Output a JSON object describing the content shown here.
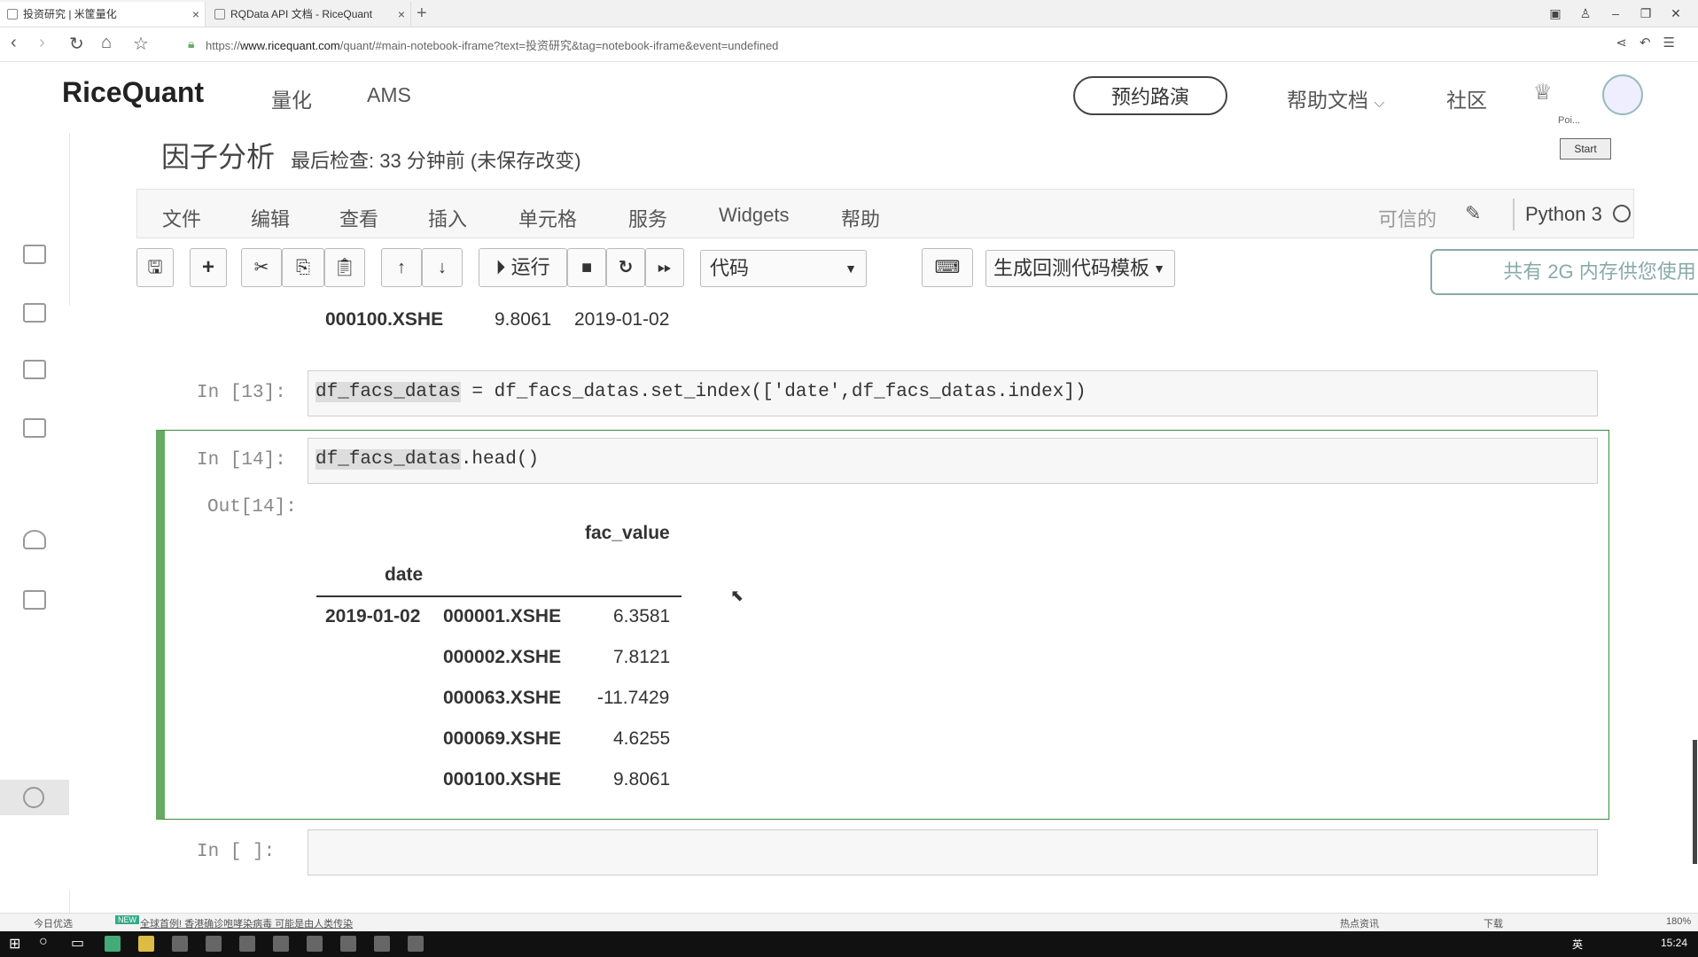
{
  "browser": {
    "tabs": [
      {
        "title": "投资研究 | 米筐量化"
      },
      {
        "title": "RQData API 文档 - RiceQuant"
      }
    ],
    "url_prefix": "https://",
    "url_host": "www.ricequant.com",
    "url_rest": "/quant/#main-notebook-iframe?text=投资研究&tag=notebook-iframe&event=undefined"
  },
  "site": {
    "logo": "RiceQuant",
    "nav": [
      "量化",
      "AMS"
    ],
    "demo_button": "预约路演",
    "help_docs": "帮助文档",
    "community": "社区",
    "start_label": "Poi...",
    "start_button": "Start"
  },
  "notebook": {
    "title": "因子分析",
    "meta": "最后检查: 33 分钟前  (未保存改变)",
    "menu": [
      "文件",
      "编辑",
      "查看",
      "插入",
      "单元格",
      "服务",
      "Widgets",
      "帮助"
    ],
    "trusted": "可信的",
    "kernel": "Python 3",
    "toolbar": {
      "run_label": "运行",
      "cell_type": "代码",
      "template": "生成回测代码模板",
      "memory": "共有 2G 内存供您使用"
    }
  },
  "cells": {
    "prev_output_row": {
      "code": "000100.XSHE",
      "value": "9.8061",
      "date": "2019-01-02"
    },
    "cell13": {
      "prompt": "In  [13]:",
      "var": "df_facs_datas",
      "code_rest": " = df_facs_datas.set_index(['date',df_facs_datas.index])"
    },
    "cell14": {
      "prompt": "In  [14]:",
      "var": "df_facs_datas",
      "code_rest": ".head()",
      "out_prompt": "Out[14]:",
      "table": {
        "column": "fac_value",
        "index_name": "date",
        "date": "2019-01-02",
        "rows": [
          {
            "code": "000001.XSHE",
            "value": "6.3581"
          },
          {
            "code": "000002.XSHE",
            "value": "7.8121"
          },
          {
            "code": "000063.XSHE",
            "value": "-11.7429"
          },
          {
            "code": "000069.XSHE",
            "value": "4.6255"
          },
          {
            "code": "000100.XSHE",
            "value": "9.8061"
          }
        ]
      }
    },
    "empty_cell": {
      "prompt": "In  [ ]:"
    }
  },
  "statusbar": {
    "left": "今日优选",
    "news": "全球首例! 香港确诊咆哮染病毒 可能是由人类传染",
    "right_items": [
      "热点资讯",
      "下载"
    ],
    "zoom": "180%"
  },
  "taskbar": {
    "lang": "英",
    "time": "15:24"
  }
}
